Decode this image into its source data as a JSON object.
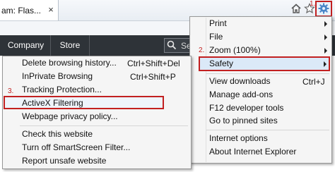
{
  "browser": {
    "tab_title": "am: Flas...",
    "tab_close": "×",
    "icons": {
      "home": "home-icon",
      "favorites": "star-icon",
      "tools": "gear-icon"
    },
    "step1_label": "1."
  },
  "page": {
    "nav_items": [
      "Company",
      "Store"
    ],
    "search_partial": "Se"
  },
  "tools_menu": {
    "step2_label": "2.",
    "items": {
      "print": "Print",
      "file": "File",
      "zoom": "Zoom (100%)",
      "safety": "Safety",
      "view_downloads": "View downloads",
      "view_downloads_shortcut": "Ctrl+J",
      "manage_addons": "Manage add-ons",
      "f12_tools": "F12 developer tools",
      "pinned_sites": "Go to pinned sites",
      "internet_options": "Internet options",
      "about_ie": "About Internet Explorer"
    }
  },
  "safety_menu": {
    "step3_label": "3.",
    "items": {
      "delete_history": "Delete browsing history...",
      "delete_history_shortcut": "Ctrl+Shift+Del",
      "inprivate": "InPrivate Browsing",
      "inprivate_shortcut": "Ctrl+Shift+P",
      "tracking": "Tracking Protection...",
      "activex": "ActiveX Filtering",
      "privacy_policy": "Webpage privacy policy...",
      "check_website": "Check this website",
      "smartscreen": "Turn off SmartScreen Filter...",
      "report_unsafe": "Report unsafe website"
    }
  },
  "colors": {
    "annotation_red": "#c22020",
    "nav_bar": "#2e3338",
    "menu_bg": "#f5f5f5"
  }
}
